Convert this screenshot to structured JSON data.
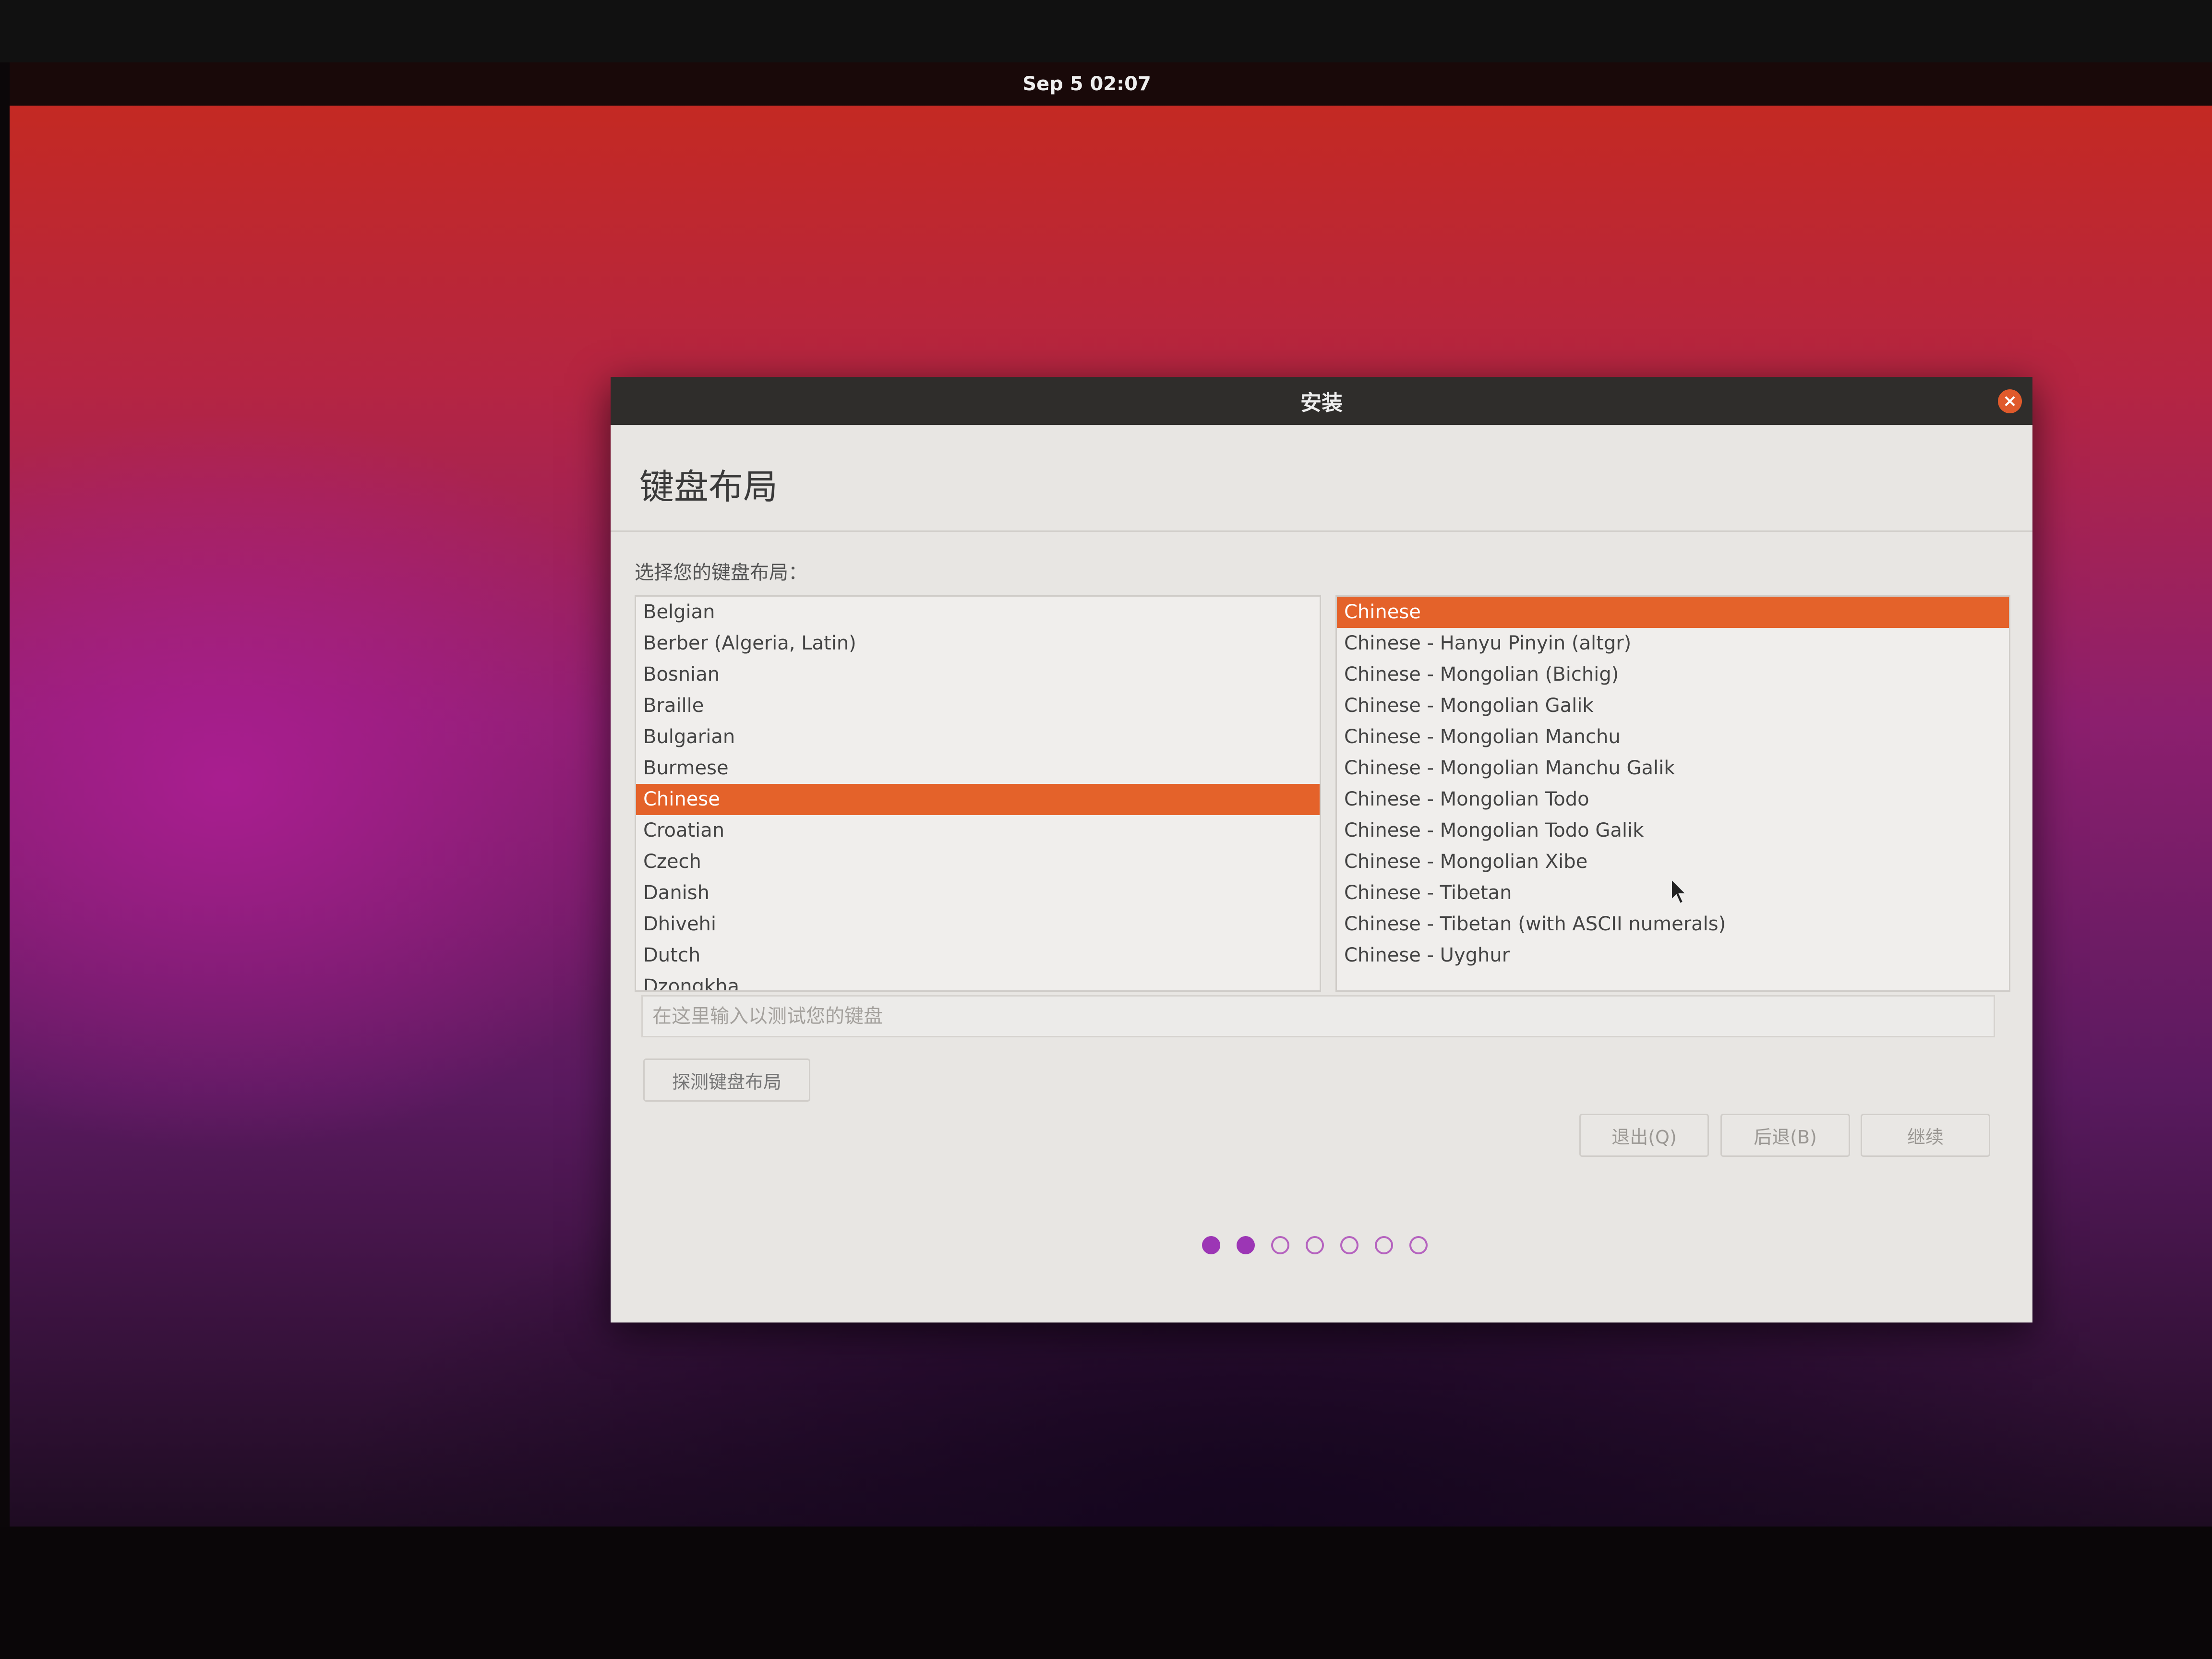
{
  "topbar": {
    "clock": "Sep 5  02:07"
  },
  "window": {
    "title": "安装",
    "close_icon": "close-icon",
    "heading": "键盘布局",
    "prompt": "选择您的键盘布局：",
    "layouts": [
      "Belgian",
      "Berber (Algeria, Latin)",
      "Bosnian",
      "Braille",
      "Bulgarian",
      "Burmese",
      "Chinese",
      "Croatian",
      "Czech",
      "Danish",
      "Dhivehi",
      "Dutch",
      "Dzongkha"
    ],
    "selected_layout": "Chinese",
    "variants": [
      "Chinese",
      "Chinese - Hanyu Pinyin (altgr)",
      "Chinese - Mongolian (Bichig)",
      "Chinese - Mongolian Galik",
      "Chinese - Mongolian Manchu",
      "Chinese - Mongolian Manchu Galik",
      "Chinese - Mongolian Todo",
      "Chinese - Mongolian Todo Galik",
      "Chinese - Mongolian Xibe",
      "Chinese - Tibetan",
      "Chinese - Tibetan (with ASCII numerals)",
      "Chinese - Uyghur"
    ],
    "selected_variant": "Chinese",
    "test_input": {
      "placeholder": "在这里输入以测试您的键盘",
      "value": ""
    },
    "detect_button": "探测键盘布局",
    "quit_button": "退出(Q)",
    "back_button": "后退(B)",
    "continue_button": "继续",
    "progress": {
      "total_steps": 7,
      "completed_steps": 2
    },
    "accent_color": "#E4622A"
  }
}
